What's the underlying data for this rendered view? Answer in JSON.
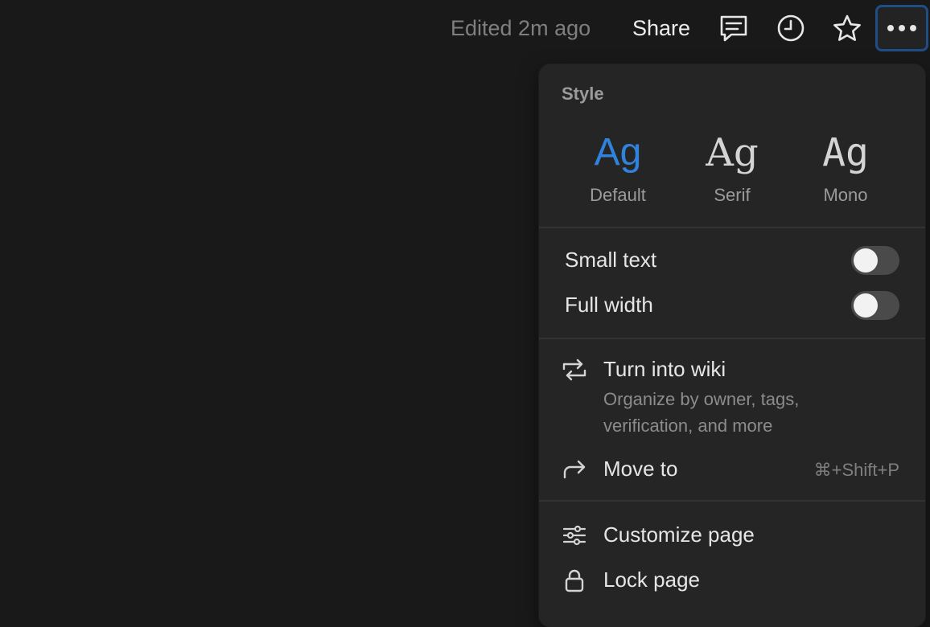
{
  "topbar": {
    "edited": "Edited 2m ago",
    "share_label": "Share",
    "icons": [
      "comment-icon",
      "clock-icon",
      "star-icon",
      "more-icon"
    ]
  },
  "menu": {
    "style_label": "Style",
    "styles": [
      {
        "sample": "Ag",
        "label": "Default",
        "active": true
      },
      {
        "sample": "Ag",
        "label": "Serif",
        "active": false
      },
      {
        "sample": "Ag",
        "label": "Mono",
        "active": false
      }
    ],
    "toggles": [
      {
        "label": "Small text",
        "on": false
      },
      {
        "label": "Full width",
        "on": false
      }
    ],
    "turn_into_wiki": {
      "title": "Turn into wiki",
      "desc_line1": "Organize by owner, tags,",
      "desc_line2": "verification, and more"
    },
    "move_to": {
      "title": "Move to",
      "shortcut": "⌘+Shift+P"
    },
    "customize_page": {
      "title": "Customize page"
    },
    "lock_page": {
      "title": "Lock page"
    }
  },
  "colors": {
    "background": "#191919",
    "menu_bg": "#252525",
    "accent": "#2f83dc",
    "focus_ring": "#1f4e86"
  }
}
